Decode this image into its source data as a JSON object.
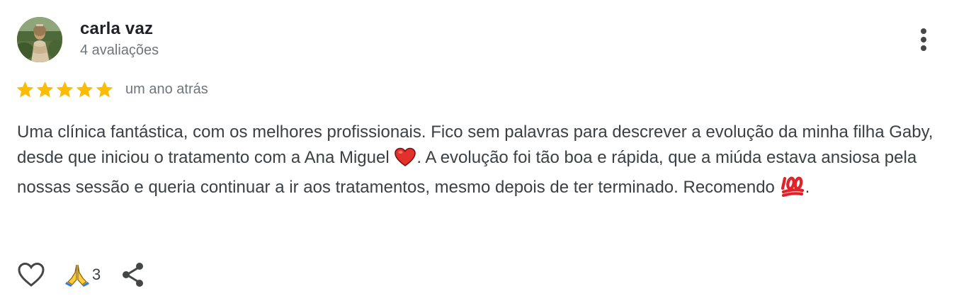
{
  "author": {
    "name": "carla vaz",
    "meta": "4 avaliações",
    "avatar": "profile-photo"
  },
  "rating": {
    "stars": 5,
    "max": 5,
    "date": "um ano atrás",
    "star_color": "#fbbc04"
  },
  "review": {
    "text_1": "Uma clínica fantástica, com os melhores profissionais. Fico sem palavras para descrever a evolução da minha filha Gaby, desde que iniciou o tratamento com a Ana Miguel",
    "emoji_1": "heart-emoji",
    "text_2": ". A evolução foi tão boa e rápida, que a miúda estava ansiosa pela nossas sessão e queria continuar a ir aos tratamentos, mesmo depois de ter terminado. Recomendo",
    "emoji_2": "hundred-points-emoji",
    "text_3": "."
  },
  "actions": {
    "like_icon": "heart-outline-icon",
    "reaction_icon": "folded-hands-emoji",
    "reaction_count": "3",
    "share_icon": "share-icon"
  },
  "colors": {
    "text": "#3c4043",
    "muted": "#70757a",
    "star": "#fbbc04"
  }
}
